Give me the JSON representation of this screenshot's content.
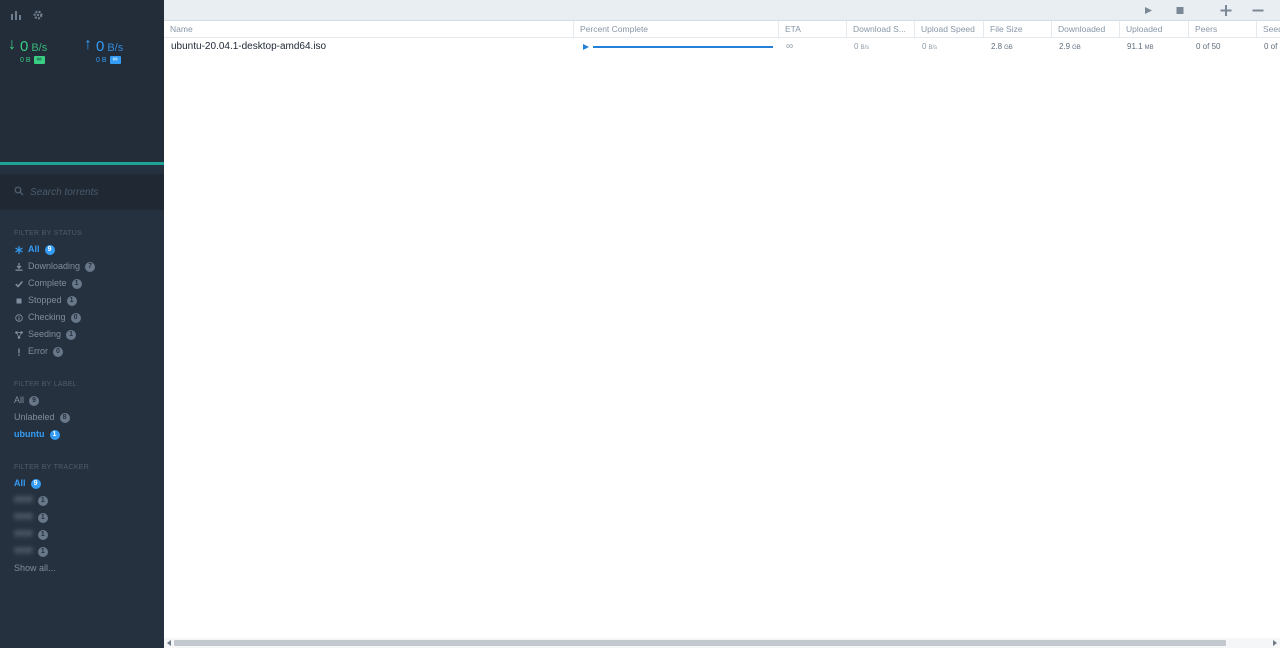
{
  "sidebar": {
    "download": {
      "value": "0",
      "unit": "B/s",
      "total": "0 B",
      "limit": "∞"
    },
    "upload": {
      "value": "0",
      "unit": "B/s",
      "total": "0 B",
      "limit": "∞"
    },
    "search_placeholder": "Search torrents",
    "status_title": "Filter by Status",
    "status_filters": [
      {
        "label": "All",
        "count": "9",
        "icon": "asterisk-icon",
        "active": true
      },
      {
        "label": "Downloading",
        "count": "7",
        "icon": "download-icon"
      },
      {
        "label": "Complete",
        "count": "1",
        "icon": "check-icon"
      },
      {
        "label": "Stopped",
        "count": "1",
        "icon": "stop-icon"
      },
      {
        "label": "Checking",
        "count": "0",
        "icon": "info-icon"
      },
      {
        "label": "Seeding",
        "count": "1",
        "icon": "seed-icon"
      },
      {
        "label": "Error",
        "count": "0",
        "icon": "exclamation-icon"
      }
    ],
    "label_title": "Filter by Label",
    "label_filters": [
      {
        "label": "All",
        "count": "9"
      },
      {
        "label": "Unlabeled",
        "count": "8"
      },
      {
        "label": "ubuntu",
        "count": "1",
        "active": true
      }
    ],
    "tracker_title": "Filter by Tracker",
    "tracker_filters": [
      {
        "label": "All",
        "count": "9",
        "active": true
      },
      {
        "label": "ffffffff",
        "count": "1",
        "blurred": true
      },
      {
        "label": "ffffffff",
        "count": "1",
        "blurred": true
      },
      {
        "label": "ffffffff",
        "count": "1",
        "blurred": true
      },
      {
        "label": "ffffffff",
        "count": "1",
        "blurred": true
      }
    ],
    "show_all": "Show all..."
  },
  "table": {
    "columns": [
      "Name",
      "Percent Complete",
      "ETA",
      "Download S...",
      "Upload Speed",
      "File Size",
      "Downloaded",
      "Uploaded",
      "Peers",
      "Seed"
    ],
    "rows": [
      {
        "name": "ubuntu-20.04.1-desktop-amd64.iso",
        "percent": 1.0,
        "eta": "∞",
        "download_speed": {
          "value": "0",
          "unit": "B/s"
        },
        "upload_speed": {
          "value": "0",
          "unit": "B/s"
        },
        "file_size": {
          "value": "2.8",
          "unit": "GB"
        },
        "downloaded": {
          "value": "2.9",
          "unit": "GB"
        },
        "uploaded": {
          "value": "91.1",
          "unit": "MB"
        },
        "peers": "0 of 50",
        "seeds": "0 of"
      }
    ]
  },
  "colors": {
    "sidebar_bg": "#26313f",
    "download_green": "#39ce83",
    "upload_blue": "#349cf4",
    "progress_blue": "#2580d6"
  }
}
